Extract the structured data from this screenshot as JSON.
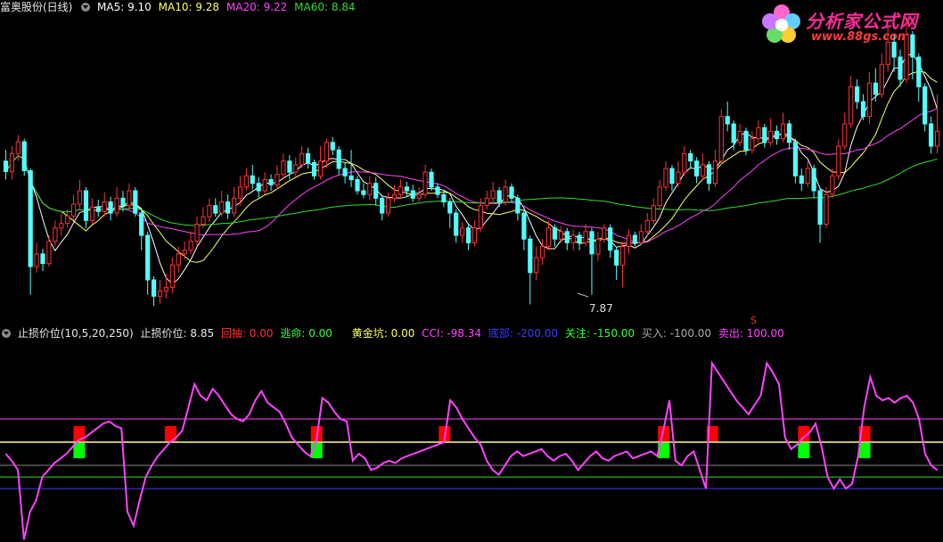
{
  "top": {
    "stock": "富奥股份(日线)",
    "ma5": "MA5: 9.10",
    "ma10": "MA10: 9.28",
    "ma20": "MA20: 9.22",
    "ma60": "MA60: 8.84",
    "low_label": "7.87",
    "s_marker": "S"
  },
  "bottom": {
    "indicator": "止损价位(10,5,20,250)",
    "stop": "止损价位: 8.85",
    "pullback": "回抽: 0.00",
    "escape": "逃命: 0.00",
    "golden_pit": "黄金坑: 0.00",
    "cci": "CCI: -98.34",
    "bottom": "底部: -200.00",
    "attention": "关注: -150.00",
    "buy": "买入: -100.00",
    "sell": "卖出: 100.00"
  },
  "logo": {
    "title": "分析家公式网",
    "url": "www.88gs.com"
  },
  "colors": {
    "up": "#ff3232",
    "down": "#54ffff",
    "ma5": "#ffffff",
    "ma10": "#ffff66",
    "ma20": "#ff44ff",
    "ma60": "#33dd33",
    "cci": "#ff44ff",
    "buy_bar": "#00ff00",
    "sell_bar": "#ff0000"
  },
  "chart_data": [
    {
      "type": "candlestick",
      "ylim": [
        7.6,
        11.8
      ],
      "candles": [
        [
          9.8,
          9.66,
          9.95,
          9.55
        ],
        [
          9.66,
          9.9,
          10.0,
          9.55
        ],
        [
          9.9,
          10.06,
          10.15,
          9.8
        ],
        [
          10.06,
          9.67,
          10.1,
          9.6
        ],
        [
          9.67,
          8.38,
          9.7,
          8.0
        ],
        [
          8.38,
          8.55,
          8.7,
          8.3
        ],
        [
          8.55,
          8.42,
          8.62,
          8.32
        ],
        [
          8.42,
          8.72,
          8.8,
          8.38
        ],
        [
          8.72,
          8.9,
          9.0,
          8.65
        ],
        [
          8.9,
          8.96,
          9.1,
          8.8
        ],
        [
          8.96,
          9.06,
          9.15,
          8.9
        ],
        [
          9.06,
          9.22,
          9.35,
          9.0
        ],
        [
          9.22,
          9.4,
          9.55,
          9.15
        ],
        [
          9.4,
          9.0,
          9.45,
          8.9
        ],
        [
          9.0,
          9.18,
          9.3,
          8.95
        ],
        [
          9.18,
          9.12,
          9.28,
          9.05
        ],
        [
          9.12,
          9.25,
          9.38,
          9.05
        ],
        [
          9.25,
          9.1,
          9.32,
          9.0
        ],
        [
          9.1,
          9.3,
          9.45,
          9.05
        ],
        [
          9.3,
          9.2,
          9.4,
          9.12
        ],
        [
          9.2,
          9.4,
          9.5,
          9.15
        ],
        [
          9.4,
          9.1,
          9.45,
          9.05
        ],
        [
          9.1,
          8.8,
          9.15,
          8.6
        ],
        [
          8.8,
          8.2,
          8.85,
          8.0
        ],
        [
          8.2,
          7.98,
          8.25,
          7.85
        ],
        [
          7.98,
          8.05,
          8.2,
          7.88
        ],
        [
          8.05,
          8.1,
          8.28,
          7.95
        ],
        [
          8.1,
          8.4,
          8.5,
          8.02
        ],
        [
          8.4,
          8.55,
          8.65,
          8.3
        ],
        [
          8.55,
          8.6,
          8.72,
          8.48
        ],
        [
          8.6,
          8.72,
          8.85,
          8.55
        ],
        [
          8.72,
          8.95,
          9.05,
          8.65
        ],
        [
          8.95,
          9.05,
          9.18,
          8.9
        ],
        [
          9.05,
          9.2,
          9.3,
          8.98
        ],
        [
          9.2,
          9.1,
          9.3,
          9.05
        ],
        [
          9.1,
          9.25,
          9.4,
          9.05
        ],
        [
          9.25,
          9.1,
          9.35,
          9.02
        ],
        [
          9.1,
          9.3,
          9.45,
          9.05
        ],
        [
          9.3,
          9.45,
          9.6,
          9.2
        ],
        [
          9.45,
          9.6,
          9.7,
          9.4
        ],
        [
          9.6,
          9.5,
          9.75,
          9.42
        ],
        [
          9.5,
          9.4,
          9.58,
          9.3
        ],
        [
          9.4,
          9.55,
          9.65,
          9.35
        ],
        [
          9.55,
          9.48,
          9.62,
          9.4
        ],
        [
          9.48,
          9.62,
          9.75,
          9.42
        ],
        [
          9.62,
          9.8,
          9.9,
          9.55
        ],
        [
          9.8,
          9.65,
          9.88,
          9.55
        ],
        [
          9.65,
          9.75,
          9.85,
          9.58
        ],
        [
          9.75,
          9.9,
          10.0,
          9.7
        ],
        [
          9.9,
          9.78,
          9.98,
          9.7
        ],
        [
          9.78,
          9.6,
          9.82,
          9.55
        ],
        [
          9.6,
          9.8,
          10.0,
          9.55
        ],
        [
          9.8,
          10.05,
          10.1,
          9.7
        ],
        [
          10.05,
          9.95,
          10.12,
          9.88
        ],
        [
          9.95,
          9.7,
          10.0,
          9.62
        ],
        [
          9.7,
          9.6,
          9.78,
          9.5
        ],
        [
          9.6,
          9.55,
          9.95,
          9.45
        ],
        [
          9.55,
          9.4,
          9.6,
          9.35
        ],
        [
          9.4,
          9.35,
          9.5,
          9.3
        ],
        [
          9.35,
          9.5,
          9.6,
          9.28
        ],
        [
          9.5,
          9.3,
          9.58,
          9.2
        ],
        [
          9.3,
          9.1,
          9.35,
          9.0
        ],
        [
          9.1,
          9.3,
          9.38,
          9.05
        ],
        [
          9.3,
          9.35,
          9.48,
          9.25
        ],
        [
          9.35,
          9.45,
          9.55,
          9.3
        ],
        [
          9.45,
          9.4,
          9.52,
          9.32
        ],
        [
          9.4,
          9.3,
          9.48,
          9.25
        ],
        [
          9.3,
          9.35,
          9.45,
          9.25
        ],
        [
          9.35,
          9.65,
          9.75,
          9.3
        ],
        [
          9.65,
          9.45,
          9.7,
          9.4
        ],
        [
          9.45,
          9.35,
          9.5,
          9.3
        ],
        [
          9.35,
          9.25,
          9.4,
          9.18
        ],
        [
          9.25,
          9.1,
          9.3,
          8.9
        ],
        [
          9.1,
          8.8,
          9.15,
          8.7
        ],
        [
          8.8,
          8.9,
          8.98,
          8.7
        ],
        [
          8.9,
          8.7,
          8.95,
          8.6
        ],
        [
          8.7,
          8.9,
          9.0,
          8.65
        ],
        [
          8.9,
          9.2,
          9.3,
          8.85
        ],
        [
          9.2,
          9.3,
          9.4,
          9.15
        ],
        [
          9.3,
          9.4,
          9.52,
          9.22
        ],
        [
          9.4,
          9.25,
          9.45,
          9.18
        ],
        [
          9.25,
          9.45,
          9.55,
          9.2
        ],
        [
          9.45,
          9.3,
          9.5,
          9.25
        ],
        [
          9.3,
          9.1,
          9.35,
          9.0
        ],
        [
          9.1,
          8.75,
          9.15,
          8.6
        ],
        [
          8.75,
          8.3,
          8.8,
          7.87
        ],
        [
          8.3,
          8.5,
          8.65,
          8.2
        ],
        [
          8.5,
          8.65,
          8.75,
          8.4
        ],
        [
          8.65,
          8.9,
          9.0,
          8.6
        ],
        [
          8.9,
          8.75,
          8.95,
          8.65
        ],
        [
          8.75,
          8.85,
          8.92,
          8.7
        ],
        [
          8.85,
          8.7,
          8.9,
          8.6
        ],
        [
          8.7,
          8.8,
          8.88,
          8.6
        ],
        [
          8.8,
          8.7,
          8.85,
          8.6
        ],
        [
          8.7,
          8.85,
          8.95,
          8.65
        ],
        [
          8.85,
          8.55,
          8.9,
          8.0
        ],
        [
          8.55,
          8.75,
          8.85,
          8.45
        ],
        [
          8.75,
          8.9,
          8.95,
          8.7
        ],
        [
          8.9,
          8.6,
          8.95,
          8.5
        ],
        [
          8.6,
          8.4,
          8.65,
          8.2
        ],
        [
          8.4,
          8.65,
          8.72,
          8.1
        ],
        [
          8.65,
          8.8,
          8.88,
          8.55
        ],
        [
          8.8,
          8.7,
          8.85,
          8.65
        ],
        [
          8.7,
          8.85,
          8.95,
          8.68
        ],
        [
          8.85,
          9.0,
          9.1,
          8.8
        ],
        [
          9.0,
          9.2,
          9.3,
          8.95
        ],
        [
          9.2,
          9.45,
          9.55,
          9.15
        ],
        [
          9.45,
          9.7,
          9.8,
          9.4
        ],
        [
          9.7,
          9.5,
          9.75,
          9.4
        ],
        [
          9.5,
          9.65,
          9.8,
          9.45
        ],
        [
          9.65,
          9.9,
          10.0,
          9.6
        ],
        [
          9.9,
          9.8,
          9.95,
          9.7
        ],
        [
          9.8,
          9.6,
          9.85,
          9.5
        ],
        [
          9.6,
          9.75,
          9.9,
          9.55
        ],
        [
          9.75,
          9.5,
          9.8,
          9.4
        ],
        [
          9.5,
          9.8,
          9.95,
          9.45
        ],
        [
          9.8,
          10.4,
          10.5,
          9.75
        ],
        [
          10.4,
          10.3,
          10.6,
          10.2
        ],
        [
          10.3,
          10.05,
          10.35,
          9.95
        ],
        [
          10.05,
          10.2,
          10.3,
          10.0
        ],
        [
          10.2,
          9.95,
          10.25,
          9.88
        ],
        [
          9.95,
          10.1,
          10.2,
          9.9
        ],
        [
          10.1,
          10.25,
          10.35,
          10.05
        ],
        [
          10.25,
          10.05,
          10.3,
          9.98
        ],
        [
          10.05,
          10.2,
          10.38,
          10.0
        ],
        [
          10.2,
          10.1,
          10.28,
          10.02
        ],
        [
          10.1,
          10.3,
          10.45,
          10.05
        ],
        [
          10.3,
          10.05,
          10.35,
          9.95
        ],
        [
          10.05,
          9.6,
          10.1,
          9.5
        ],
        [
          9.6,
          9.5,
          9.7,
          9.4
        ],
        [
          9.5,
          9.7,
          9.8,
          9.45
        ],
        [
          9.7,
          9.4,
          9.75,
          9.3
        ],
        [
          9.4,
          8.95,
          9.45,
          8.7
        ],
        [
          8.95,
          9.35,
          9.45,
          8.9
        ],
        [
          9.35,
          9.6,
          9.7,
          9.3
        ],
        [
          9.6,
          10.0,
          10.1,
          9.55
        ],
        [
          10.0,
          10.3,
          10.45,
          9.95
        ],
        [
          10.3,
          10.8,
          10.95,
          10.25
        ],
        [
          10.8,
          10.6,
          10.9,
          10.5
        ],
        [
          10.6,
          10.4,
          10.7,
          10.35
        ],
        [
          10.4,
          10.85,
          11.0,
          10.3
        ],
        [
          10.85,
          10.7,
          11.05,
          10.6
        ],
        [
          10.7,
          11.1,
          11.25,
          10.65
        ],
        [
          11.1,
          11.4,
          11.6,
          11.0
        ],
        [
          11.4,
          11.2,
          11.5,
          11.0
        ],
        [
          11.2,
          10.9,
          11.3,
          10.8
        ],
        [
          10.9,
          11.5,
          11.7,
          10.85
        ],
        [
          11.5,
          11.2,
          11.55,
          10.9
        ],
        [
          11.2,
          10.8,
          11.25,
          10.6
        ],
        [
          10.8,
          10.3,
          10.85,
          10.2
        ],
        [
          10.3,
          10.0,
          10.4,
          9.9
        ],
        [
          10.0,
          10.2,
          10.7,
          9.9
        ]
      ]
    },
    {
      "type": "line",
      "name": "CCI",
      "ylim": [
        -430,
        430
      ],
      "levels": [
        {
          "value": 100
        },
        {
          "value": 0
        },
        {
          "value": -100
        },
        {
          "value": -150
        },
        {
          "value": -200
        }
      ],
      "values": [
        -50,
        -80,
        -120,
        -420,
        -300,
        -250,
        -150,
        -120,
        -90,
        -70,
        -50,
        -20,
        10,
        20,
        40,
        60,
        80,
        90,
        70,
        60,
        -300,
        -360,
        -250,
        -150,
        -100,
        -60,
        -30,
        0,
        20,
        50,
        150,
        250,
        200,
        180,
        230,
        200,
        160,
        120,
        100,
        90,
        120,
        180,
        220,
        170,
        150,
        130,
        80,
        20,
        -10,
        -40,
        -60,
        0,
        190,
        170,
        130,
        100,
        90,
        -80,
        -50,
        -70,
        -120,
        -110,
        -90,
        -80,
        -90,
        -70,
        -60,
        -50,
        -40,
        -30,
        -20,
        -10,
        0,
        180,
        150,
        100,
        60,
        20,
        -10,
        -80,
        -120,
        -140,
        -100,
        -60,
        -40,
        -60,
        -50,
        -40,
        -30,
        -60,
        -80,
        -60,
        -50,
        -80,
        -120,
        -90,
        -60,
        -40,
        -70,
        -80,
        -60,
        -50,
        -40,
        -70,
        -60,
        -50,
        -40,
        -60,
        50,
        180,
        -80,
        -100,
        -60,
        -40,
        -120,
        -200,
        340,
        300,
        260,
        220,
        180,
        150,
        120,
        160,
        200,
        340,
        300,
        250,
        20,
        -30,
        -10,
        20,
        40,
        80,
        -20,
        -150,
        -200,
        -160,
        -200,
        -180,
        -60,
        150,
        280,
        200,
        180,
        190,
        170,
        190,
        200,
        170,
        100,
        -50,
        -100,
        -120
      ],
      "sell_signals": 8,
      "buy_signals": 5
    }
  ]
}
